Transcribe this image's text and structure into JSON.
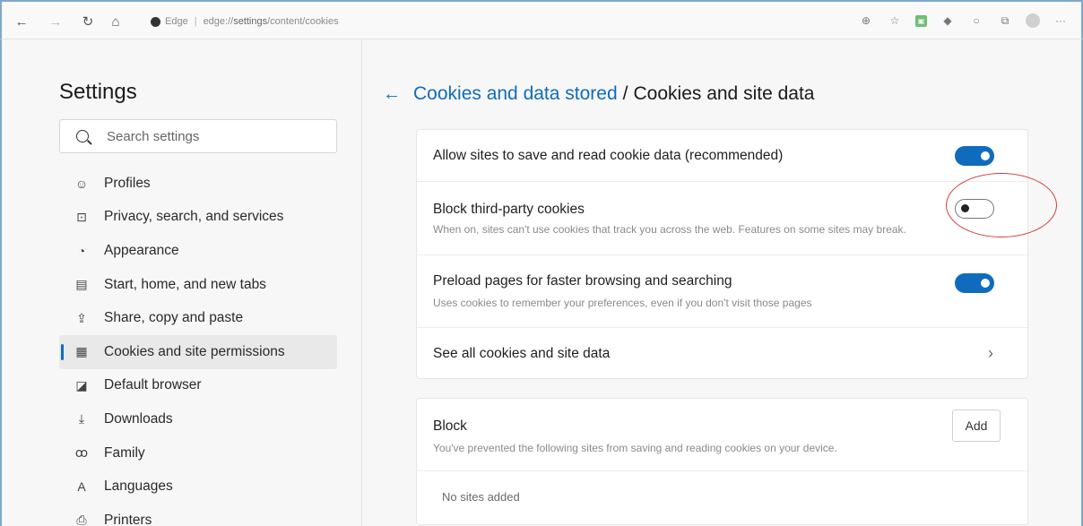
{
  "browser": {
    "brand": "Edge",
    "url_prefix": "edge://",
    "url_bold": "settings",
    "url_suffix": "/content/cookies"
  },
  "sidebar": {
    "title": "Settings",
    "search_placeholder": "Search settings",
    "items": [
      {
        "label": "Profiles",
        "icon": "profile-icon",
        "glyph": "☺"
      },
      {
        "label": "Privacy, search, and services",
        "icon": "lock-icon",
        "glyph": "⊡"
      },
      {
        "label": "Appearance",
        "icon": "appearance-icon",
        "glyph": "◔"
      },
      {
        "label": "Start, home, and new tabs",
        "icon": "start-tab-icon",
        "glyph": "▤"
      },
      {
        "label": "Share, copy and paste",
        "icon": "share-icon",
        "glyph": "⇪"
      },
      {
        "label": "Cookies and site permissions",
        "icon": "cookies-icon",
        "glyph": "▦",
        "active": true
      },
      {
        "label": "Default browser",
        "icon": "default-browser-icon",
        "glyph": "◪"
      },
      {
        "label": "Downloads",
        "icon": "download-icon",
        "glyph": "⤓"
      },
      {
        "label": "Family",
        "icon": "family-icon",
        "glyph": "ꝏ"
      },
      {
        "label": "Languages",
        "icon": "languages-icon",
        "glyph": "A"
      },
      {
        "label": "Printers",
        "icon": "printer-icon",
        "glyph": "⎙"
      }
    ]
  },
  "main": {
    "breadcrumb_parent": "Cookies and data stored",
    "breadcrumb_sep": "/",
    "breadcrumb_current": "Cookies and site data",
    "settings": [
      {
        "title": "Allow sites to save and read cookie data (recommended)",
        "desc": "",
        "enabled": true
      },
      {
        "title": "Block third-party cookies",
        "desc": "When on, sites can't use cookies that track you across the web. Features on some sites may break.",
        "enabled": false
      },
      {
        "title": "Preload pages for faster browsing and searching",
        "desc": "Uses cookies to remember your preferences, even if you don't visit those pages",
        "enabled": true
      },
      {
        "title": "See all cookies and site data",
        "desc": ""
      }
    ],
    "block": {
      "title": "Block",
      "desc": "You've prevented the following sites from saving and reading cookies on your device.",
      "add_label": "Add",
      "empty_text": "No sites added"
    }
  },
  "colors": {
    "accent": "#0f6cbd",
    "annotation": "#d33a3a"
  }
}
